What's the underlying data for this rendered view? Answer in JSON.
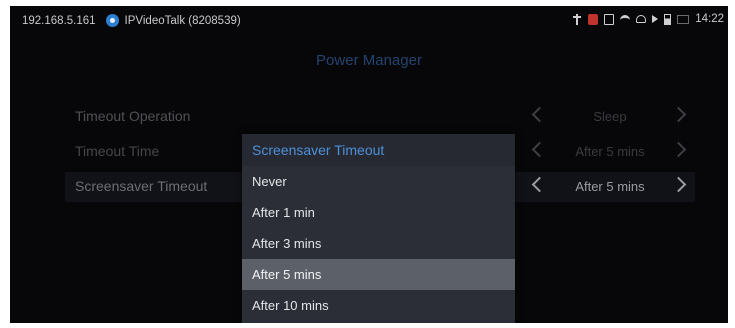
{
  "statusbar": {
    "ip": "192.168.5.161",
    "app_name": "IPVideoTalk (8208539)",
    "time": "14:22",
    "icons": [
      "usb-icon",
      "alert-icon",
      "screen-icon",
      "wifi-icon",
      "cloud-icon",
      "mute-icon",
      "battery-icon",
      "mail-icon"
    ]
  },
  "page": {
    "title": "Power Manager"
  },
  "settings": [
    {
      "label": "Timeout Operation",
      "value": "Sleep"
    },
    {
      "label": "Timeout Time",
      "value": "After 5 mins"
    },
    {
      "label": "Screensaver Timeout",
      "value": "After 5 mins"
    }
  ],
  "dialog": {
    "title": "Screensaver Timeout",
    "options": [
      "Never",
      "After 1 min",
      "After 3 mins",
      "After 5 mins",
      "After 10 mins"
    ],
    "selected_index": 3
  },
  "colors": {
    "accent": "#4e90d8",
    "dialog_bg": "#2b2e37",
    "selected_bg": "#5c6068",
    "screen_bg": "#070709"
  }
}
